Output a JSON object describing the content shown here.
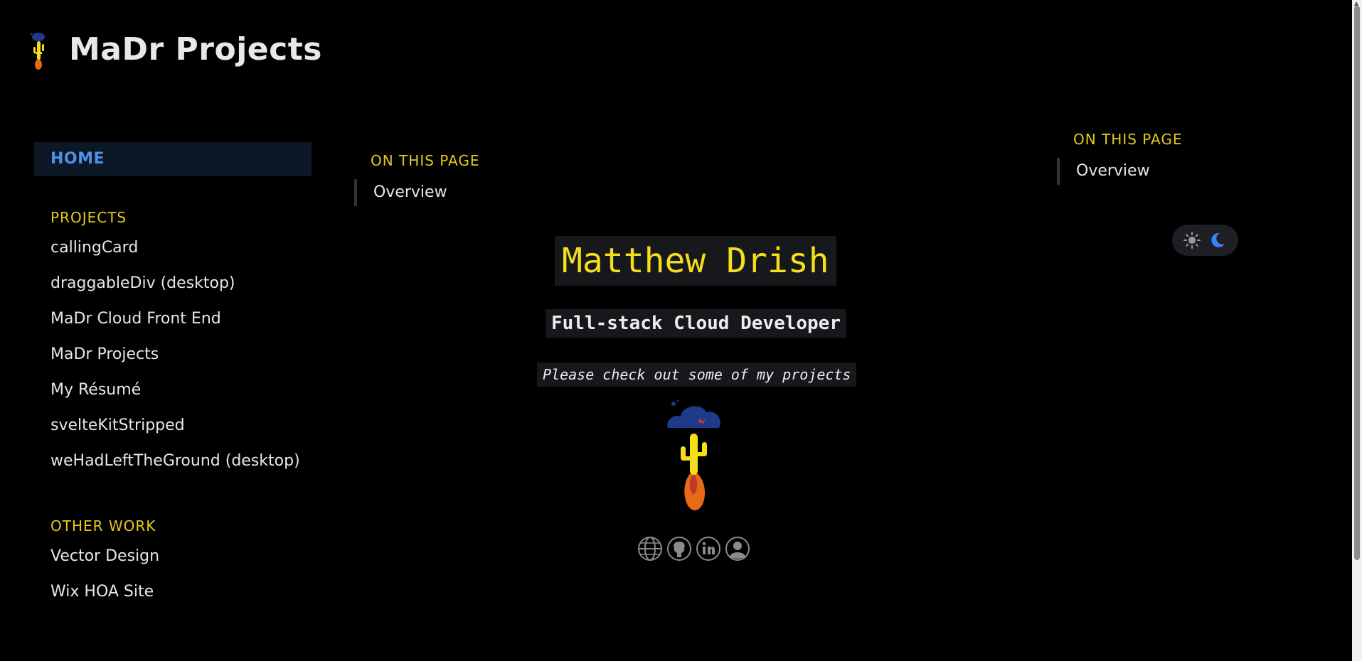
{
  "site": {
    "title": "MaDr Projects",
    "logo_icon": "rocket-cactus-logo-icon"
  },
  "sidebar": {
    "home": "HOME",
    "sections": [
      {
        "heading": "PROJECTS",
        "items": [
          "callingCard",
          "draggableDiv (desktop)",
          "MaDr Cloud Front End",
          "MaDr Projects",
          "My Résumé",
          "svelteKitStripped",
          "weHadLeftTheGround (desktop)"
        ]
      },
      {
        "heading": "OTHER WORK",
        "items": [
          "Vector Design",
          "Wix HOA Site"
        ]
      }
    ]
  },
  "toc": {
    "heading": "ON THIS PAGE",
    "link": "Overview"
  },
  "hero": {
    "name": "Matthew Drish",
    "role": "Full-stack Cloud Developer",
    "tagline": "Please check out some of my projects"
  },
  "social_icons": [
    "globe-icon",
    "github-icon",
    "linkedin-icon",
    "profile-icon"
  ],
  "theme_toggle": {
    "icons": [
      "sun-icon",
      "moon-icon"
    ]
  },
  "colors": {
    "accent_yellow": "#e6c81a",
    "home_blue": "#4f8fe6",
    "background": "#000000"
  }
}
